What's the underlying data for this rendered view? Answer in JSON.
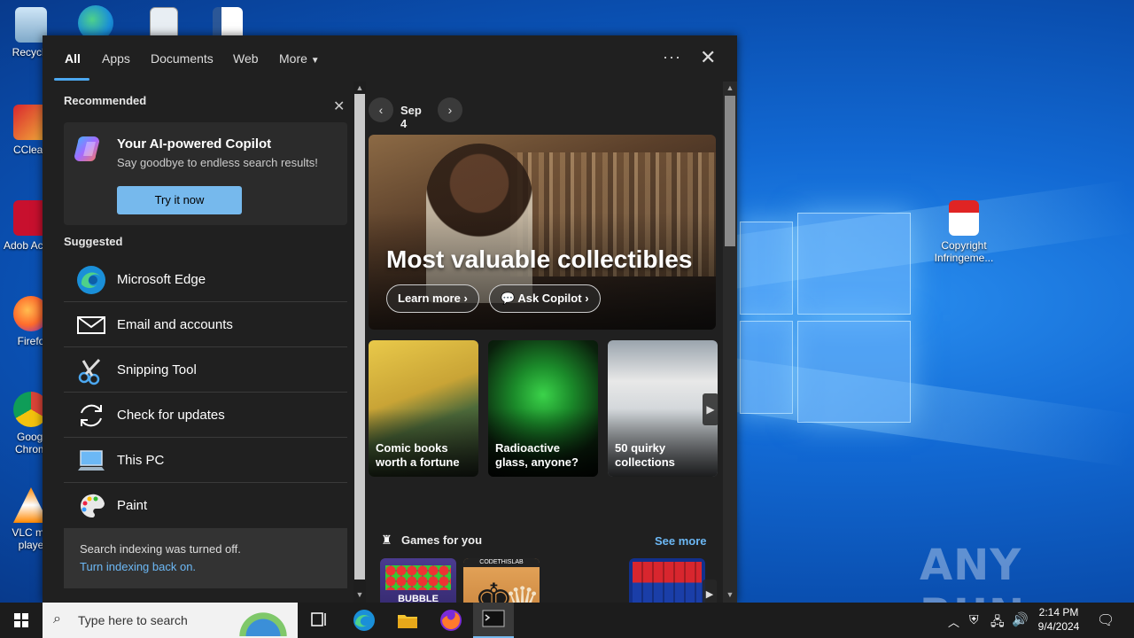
{
  "desktop": {
    "icons": [
      {
        "label": "Recycle"
      },
      {
        "label": "CClean"
      },
      {
        "label": "Adob Acrob"
      },
      {
        "label": "Firefo"
      },
      {
        "label": "Googl Chrom"
      },
      {
        "label": "VLC me playe"
      },
      {
        "label": "Copyright Infringeme..."
      }
    ],
    "watermark": "ANY RUN"
  },
  "search_panel": {
    "tabs": [
      {
        "label": "All",
        "active": true
      },
      {
        "label": "Apps"
      },
      {
        "label": "Documents"
      },
      {
        "label": "Web"
      },
      {
        "label": "More"
      }
    ],
    "more_options_label": "···",
    "recommended": {
      "title": "Recommended",
      "card": {
        "title": "Your AI-powered Copilot",
        "subtitle": "Say goodbye to endless search results!",
        "button": "Try it now"
      }
    },
    "suggested": {
      "title": "Suggested",
      "items": [
        {
          "label": "Microsoft Edge",
          "icon": "edge-icon"
        },
        {
          "label": "Email and accounts",
          "icon": "mail-icon"
        },
        {
          "label": "Snipping Tool",
          "icon": "scissors-icon"
        },
        {
          "label": "Check for updates",
          "icon": "refresh-icon"
        },
        {
          "label": "This PC",
          "icon": "computer-icon"
        },
        {
          "label": "Paint",
          "icon": "palette-icon"
        }
      ]
    },
    "indexing": {
      "message": "Search indexing was turned off.",
      "link": "Turn indexing back on."
    },
    "highlights": {
      "date": "Sep 4",
      "hero": {
        "title": "Most valuable collectibles",
        "learn_more": "Learn more",
        "ask_copilot": "Ask Copilot"
      },
      "cards": [
        {
          "title": "Comic books worth a fortune"
        },
        {
          "title": "Radioactive glass, anyone?"
        },
        {
          "title": "50 quirky collections"
        }
      ],
      "games": {
        "title": "Games for you",
        "see_more": "See more",
        "items": [
          {
            "name": "BUBBLE SHOOTER HD"
          },
          {
            "name": "CODETHISLAB"
          },
          {
            "name": "blocks"
          }
        ]
      }
    }
  },
  "taskbar": {
    "search_placeholder": "Type here to search",
    "time": "2:14 PM",
    "date": "9/4/2024"
  }
}
